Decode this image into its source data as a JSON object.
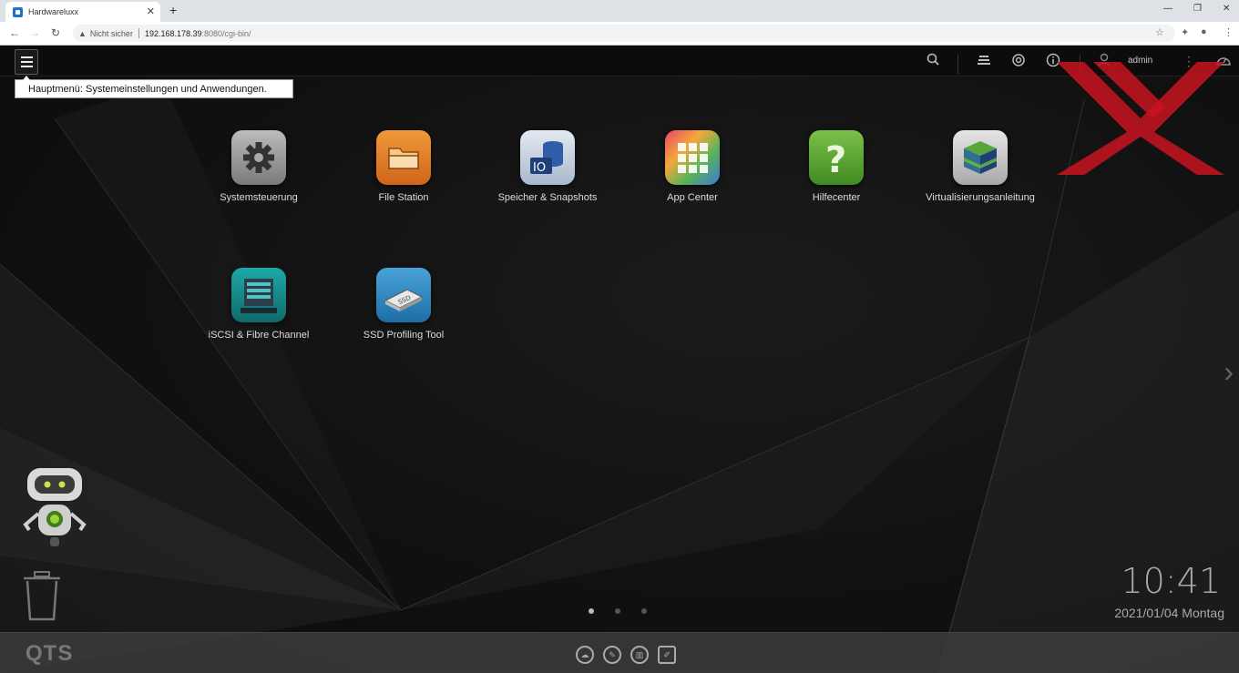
{
  "browser": {
    "tab_title": "Hardwareluxx",
    "tab_close": "✕",
    "new_tab": "+",
    "security_label": "Nicht sicher",
    "url_host": "192.168.178.39",
    "url_path": ":8080/cgi-bin/",
    "window_minimize": "—",
    "window_restore": "❐",
    "window_close": "✕"
  },
  "topbar": {
    "user": "admin",
    "menu_tooltip": "Hauptmenü: Systemeinstellungen und Anwendungen."
  },
  "desktop": {
    "apps": [
      {
        "label": "Systemsteuerung",
        "icon": "gear-icon"
      },
      {
        "label": "File Station",
        "icon": "folder-icon"
      },
      {
        "label": "Speicher & Snapshots",
        "icon": "storage-icon"
      },
      {
        "label": "App Center",
        "icon": "app-grid-icon"
      },
      {
        "label": "Hilfecenter",
        "icon": "help-icon"
      },
      {
        "label": "Virtualisierungsanleitung",
        "icon": "cube-icon"
      },
      {
        "label": "iSCSI & Fibre Channel",
        "icon": "server-icon"
      },
      {
        "label": "SSD Profiling Tool",
        "icon": "ssd-icon"
      }
    ],
    "page_count": 3,
    "active_page": 1
  },
  "clock": {
    "time": "10:41",
    "date": "2021/01/04 Montag"
  },
  "dock": {
    "logo": "QTS"
  },
  "colors": {
    "watermark": "#c8141e",
    "settings_icon": "#9a9a9a",
    "file_station_icon": "#e07a1f",
    "help_icon": "#4c9a2a"
  }
}
